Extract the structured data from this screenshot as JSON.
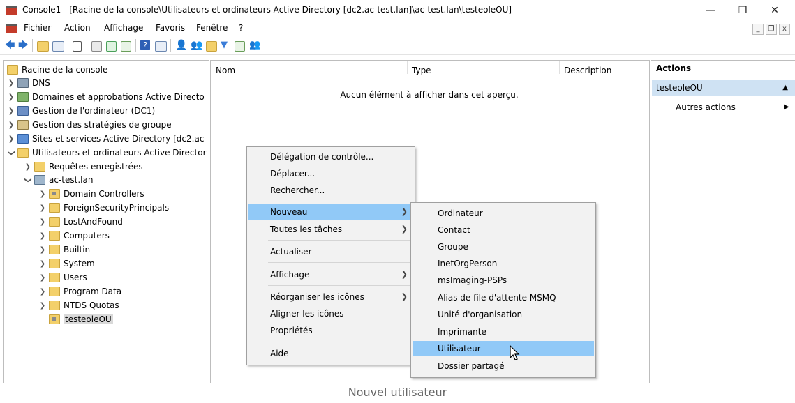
{
  "window": {
    "title": "Console1 - [Racine de la console\\Utilisateurs et ordinateurs Active Directory [dc2.ac-test.lan]\\ac-test.lan\\testeoleOU]",
    "minimize": "—",
    "maximize": "❐",
    "close": "✕"
  },
  "menubar": {
    "items": [
      "Fichier",
      "Action",
      "Affichage",
      "Favoris",
      "Fenêtre",
      "?"
    ],
    "mdi_minimize": "_",
    "mdi_restore": "❐",
    "mdi_close": "x"
  },
  "list": {
    "columns": [
      "Nom",
      "Type",
      "Description"
    ],
    "empty_message": "Aucun élément à afficher dans cet aperçu."
  },
  "tree": {
    "root": "Racine de la console",
    "top_items": [
      "DNS",
      "Domaines et approbations Active Directo",
      "Gestion de l'ordinateur (DC1)",
      "Gestion des stratégies de groupe",
      "Sites et services Active Directory [dc2.ac-",
      "Utilisateurs et ordinateurs Active Director"
    ],
    "saved_queries": "Requêtes enregistrées",
    "domain": "ac-test.lan",
    "domain_children": [
      "Domain Controllers",
      "ForeignSecurityPrincipals",
      "LostAndFound",
      "Computers",
      "Builtin",
      "System",
      "Users",
      "Program Data",
      "NTDS Quotas",
      "testeoleOU"
    ]
  },
  "actions": {
    "title": "Actions",
    "section": "testeoleOU",
    "more": "Autres actions"
  },
  "context_menu": {
    "items": [
      "Délégation de contrôle...",
      "Déplacer...",
      "Rechercher...",
      "Nouveau",
      "Toutes les tâches",
      "Actualiser",
      "Affichage",
      "Réorganiser les icônes",
      "Aligner les icônes",
      "Propriétés",
      "Aide"
    ]
  },
  "submenu": {
    "items": [
      "Ordinateur",
      "Contact",
      "Groupe",
      "InetOrgPerson",
      "msImaging-PSPs",
      "Alias de file d'attente MSMQ",
      "Unité d'organisation",
      "Imprimante",
      "Utilisateur",
      "Dossier partagé"
    ]
  },
  "caption": "Nouvel utilisateur",
  "colors": {
    "highlight": "#91c9f7",
    "actions_section": "#cfe2f3",
    "folder": "#f3d06a"
  }
}
